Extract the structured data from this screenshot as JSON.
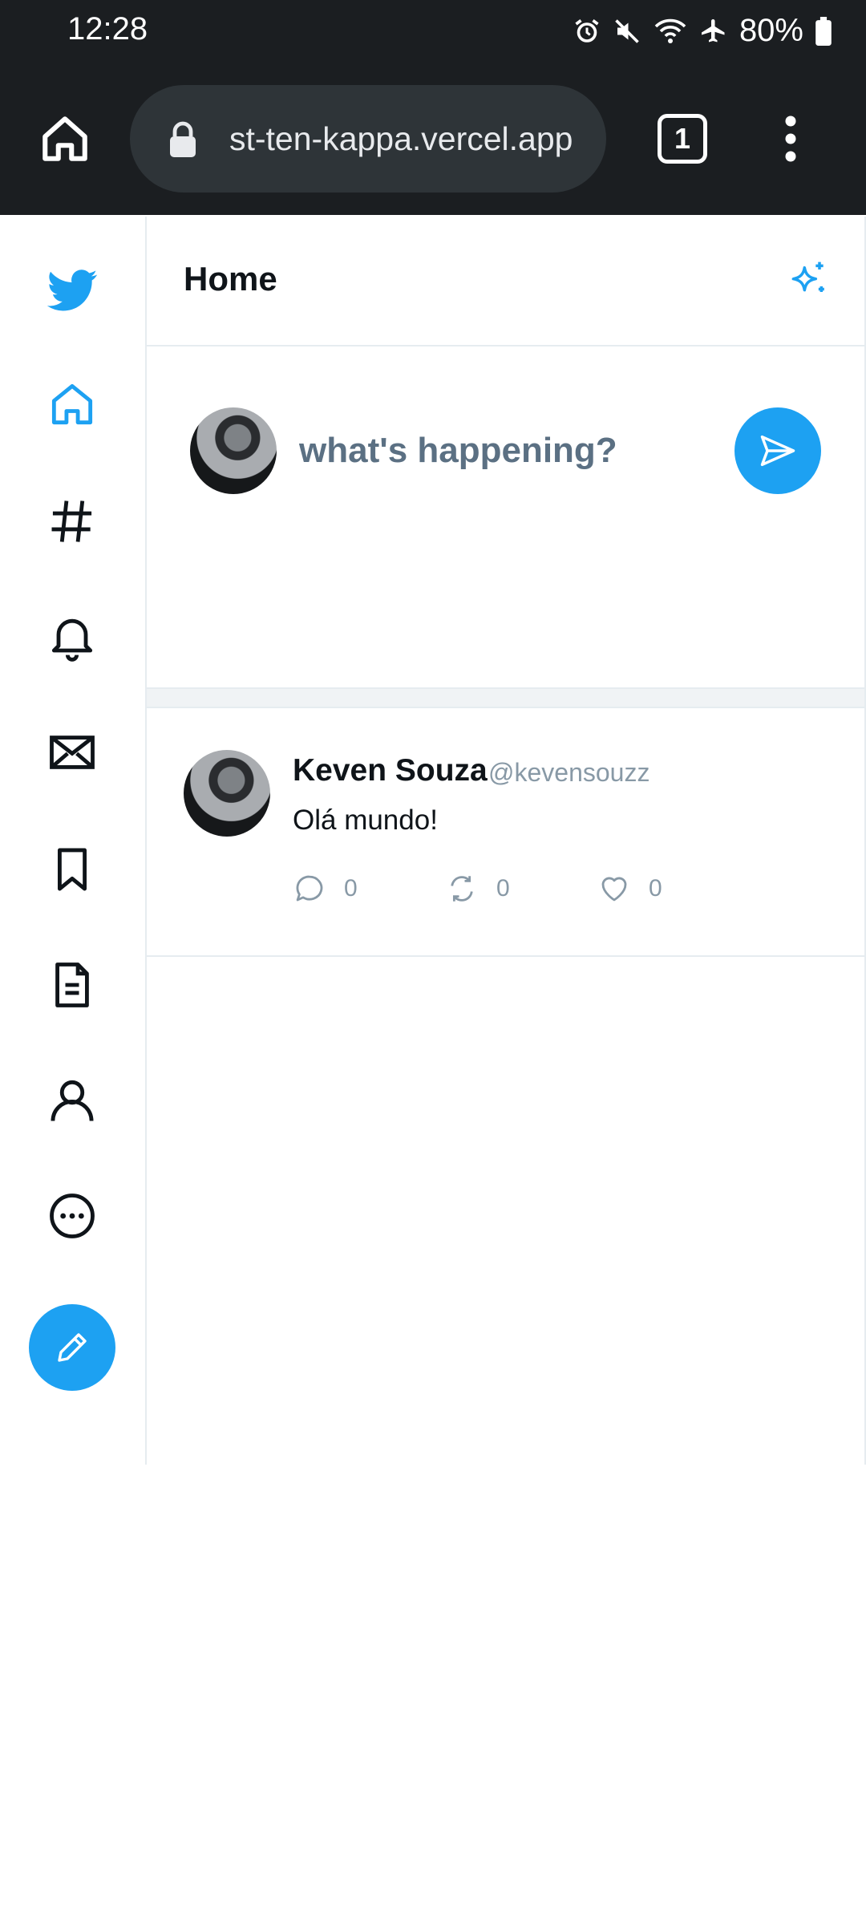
{
  "status_bar": {
    "time": "12:28",
    "battery": "80%",
    "icons": [
      "alarm-icon",
      "mute-icon",
      "wifi-icon",
      "airplane-icon",
      "battery-icon"
    ]
  },
  "browser": {
    "url": "st-ten-kappa.vercel.app",
    "tab_count": "1"
  },
  "sidebar": {
    "items": [
      "twitter-logo-icon",
      "home-icon",
      "explore-hashtag-icon",
      "notifications-bell-icon",
      "messages-envelope-icon",
      "bookmark-icon",
      "lists-document-icon",
      "profile-user-icon",
      "more-circle-icon"
    ],
    "active_item": "home-icon",
    "compose_icon": "pencil-icon"
  },
  "header": {
    "title": "Home",
    "top_tweets_icon": "sparkle-icon"
  },
  "composer": {
    "placeholder": "what's happening?"
  },
  "tweets": [
    {
      "name": "Keven Souza",
      "handle": "@kevensouzz",
      "text": "Olá mundo!",
      "replies": "0",
      "retweets": "0",
      "likes": "0"
    }
  ],
  "colors": {
    "accent": "#1da1f2",
    "chrome_bg": "#1b1e21",
    "url_pill": "#2e3438",
    "muted": "#8899a6",
    "border": "#e6ecf0"
  }
}
